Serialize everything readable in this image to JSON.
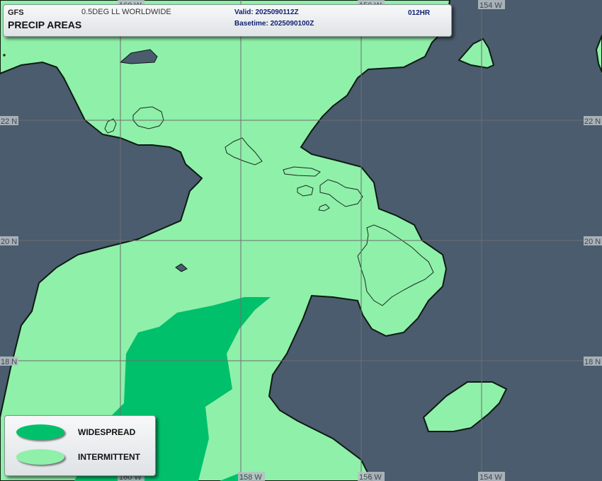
{
  "header": {
    "model": "GFS",
    "grid": "0.5DEG LL WORLDWIDE",
    "product": "PRECIP AREAS",
    "valid": "Valid: 2025090112Z",
    "basetime": "Basetime: 2025090100Z",
    "forecast_hour": "012HR"
  },
  "graticule": {
    "longitudes": [
      "160 W",
      "158 W",
      "156 W",
      "154 W"
    ],
    "latitudes": [
      "22 N",
      "20 N",
      "18 N"
    ]
  },
  "legend": {
    "items": [
      {
        "label": "WIDESPREAD",
        "color": "#00c06c"
      },
      {
        "label": "INTERMITTENT",
        "color": "#8ff0aa"
      }
    ]
  },
  "colors": {
    "ocean": "#4a5c6e",
    "intermittent": "#8ff0aa",
    "widespread": "#00c06c",
    "gridline": "#6e6e6e",
    "coastline": "#1a2a1e"
  }
}
